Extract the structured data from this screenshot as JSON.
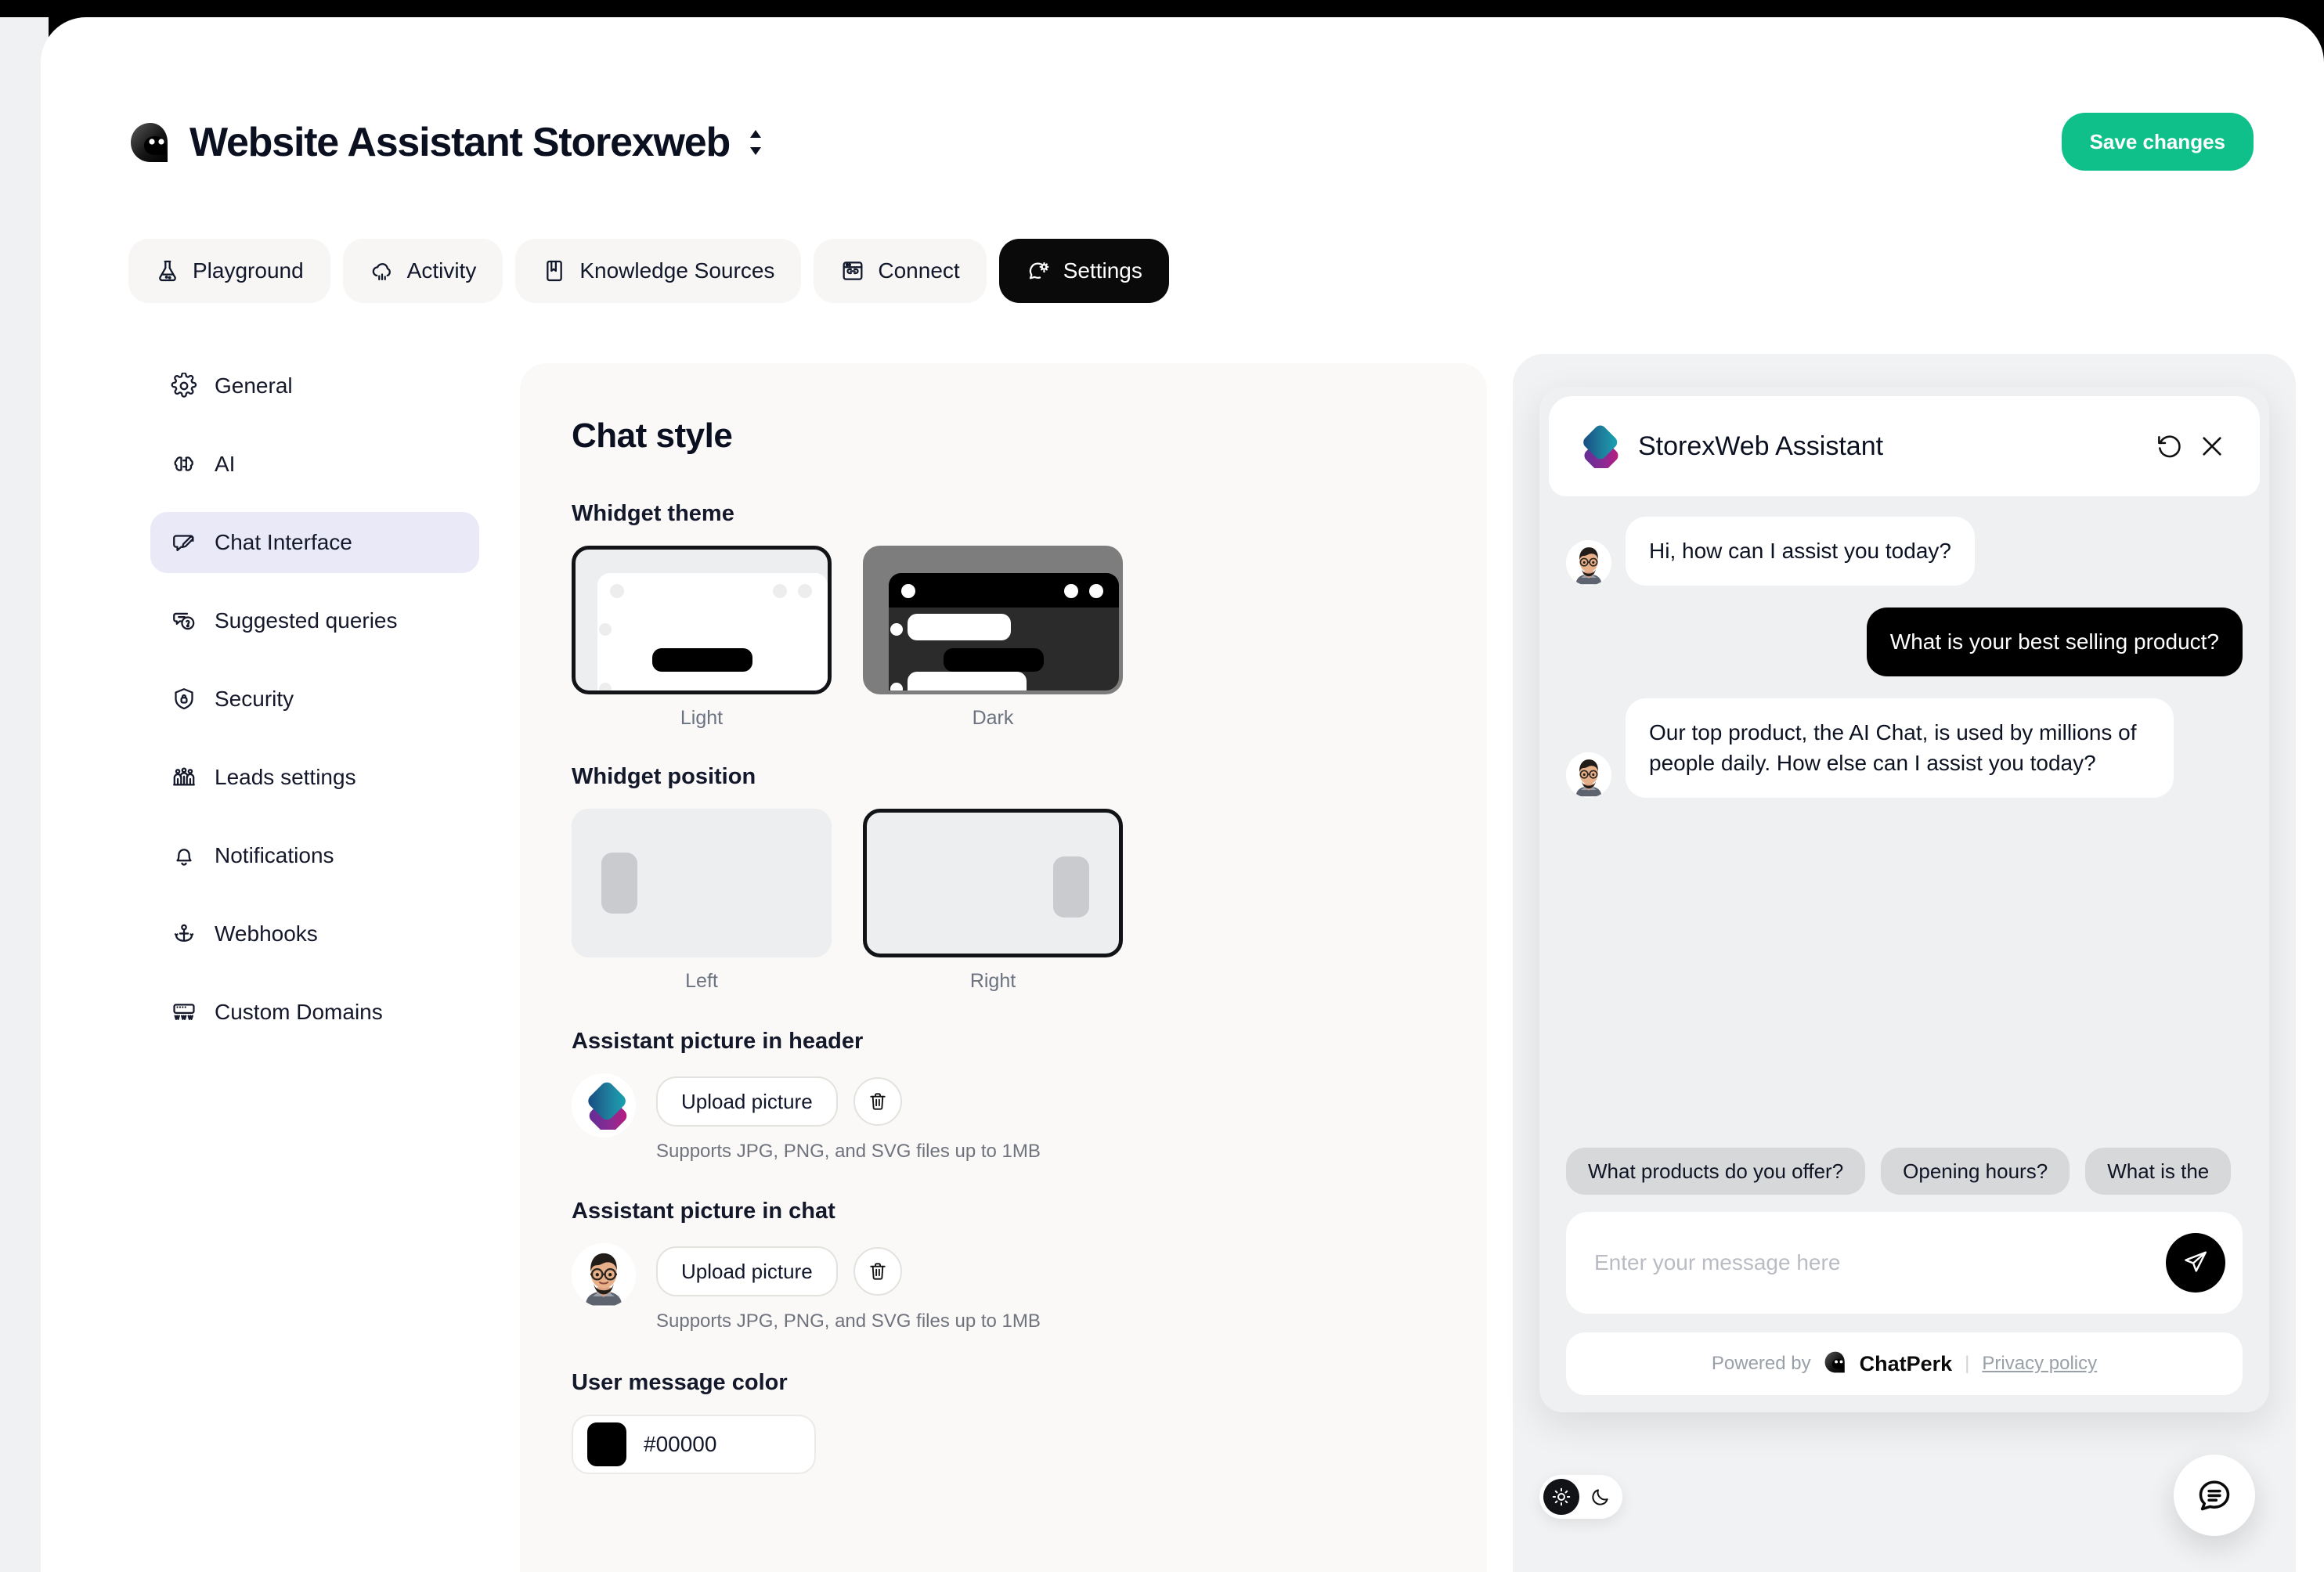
{
  "header": {
    "title": "Website Assistant Storexweb",
    "brand_icon": "chatperk-logo-icon",
    "stepper_icon": "chevron-up-down-icon",
    "save_label": "Save changes",
    "accent_color": "#10c08a"
  },
  "tabs": [
    {
      "label": "Playground",
      "icon": "flask-icon",
      "active": false
    },
    {
      "label": "Activity",
      "icon": "cloud-activity-icon",
      "active": false
    },
    {
      "label": "Knowledge Sources",
      "icon": "book-icon",
      "active": false
    },
    {
      "label": "Connect",
      "icon": "browser-link-icon",
      "active": false
    },
    {
      "label": "Settings",
      "icon": "chat-gear-icon",
      "active": true
    }
  ],
  "settings_nav": [
    {
      "label": "General",
      "icon": "gear-icon",
      "active": false
    },
    {
      "label": "AI",
      "icon": "brain-icon",
      "active": false
    },
    {
      "label": "Chat Interface",
      "icon": "chat-edit-icon",
      "active": true
    },
    {
      "label": "Suggested queries",
      "icon": "chat-question-icon",
      "active": false
    },
    {
      "label": "Security",
      "icon": "shield-lock-icon",
      "active": false
    },
    {
      "label": "Leads settings",
      "icon": "people-icon",
      "active": false
    },
    {
      "label": "Notifications",
      "icon": "bell-icon",
      "active": false
    },
    {
      "label": "Webhooks",
      "icon": "anchor-icon",
      "active": false
    },
    {
      "label": "Custom Domains",
      "icon": "www-icon",
      "active": false
    }
  ],
  "chat_style": {
    "heading": "Chat style",
    "widget_theme": {
      "label": "Whidget theme",
      "options": [
        {
          "caption": "Light",
          "selected": true
        },
        {
          "caption": "Dark",
          "selected": false
        }
      ]
    },
    "widget_position": {
      "label": "Whidget position",
      "options": [
        {
          "caption": "Left",
          "selected": false
        },
        {
          "caption": "Right",
          "selected": true
        }
      ]
    },
    "assistant_picture_header": {
      "label": "Assistant picture in header",
      "upload_label": "Upload picture",
      "delete_icon": "trash-icon",
      "hint": "Supports JPG, PNG, and SVG files up to 1MB",
      "avatar_icon": "stacked-diamonds-logo-icon"
    },
    "assistant_picture_chat": {
      "label": "Assistant picture in chat",
      "upload_label": "Upload picture",
      "delete_icon": "trash-icon",
      "hint": "Supports JPG, PNG, and SVG files up to 1MB",
      "avatar_icon": "person-avatar-icon"
    },
    "user_message_color": {
      "label": "User message color",
      "value": "#00000",
      "swatch_color": "#000000"
    }
  },
  "preview": {
    "widget_title": "StorexWeb Assistant",
    "logo_icon": "stacked-diamonds-logo-icon",
    "refresh_icon": "reset-icon",
    "close_icon": "close-icon",
    "messages": [
      {
        "role": "assistant",
        "text": "Hi, how can I assist you today?"
      },
      {
        "role": "user",
        "text": "What is your best selling product?"
      },
      {
        "role": "assistant",
        "text": "Our top product, the AI Chat, is used by millions of people daily. How else can I assist you today?"
      }
    ],
    "suggested_chips": [
      "What products do you offer?",
      "Opening hours?",
      "What is the"
    ],
    "composer": {
      "placeholder": "Enter your message here",
      "value": "",
      "send_icon": "send-plane-icon"
    },
    "footer": {
      "powered_by": "Powered by",
      "brand": "ChatPerk",
      "divider": "|",
      "privacy_link": "Privacy policy"
    },
    "theme_toggle": {
      "light_icon": "sun-icon",
      "dark_icon": "moon-icon",
      "active": "light"
    },
    "launcher_icon": "chat-bubble-lines-icon"
  }
}
